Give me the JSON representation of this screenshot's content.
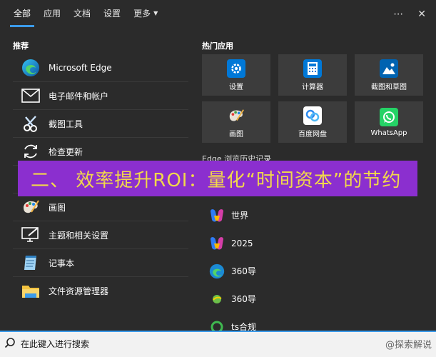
{
  "tabs": [
    {
      "label": "全部",
      "active": true
    },
    {
      "label": "应用"
    },
    {
      "label": "文档"
    },
    {
      "label": "设置"
    },
    {
      "label": "更多"
    }
  ],
  "window": {
    "more_icon": "ellipsis-icon",
    "close_icon": "close-icon"
  },
  "left": {
    "title": "推荐",
    "items": [
      {
        "label": "Microsoft Edge",
        "icon": "edge-icon"
      },
      {
        "label": "电子邮件和帐户",
        "icon": "mail-icon"
      },
      {
        "label": "截图工具",
        "icon": "snipping-tool-icon"
      },
      {
        "label": "检查更新",
        "icon": "refresh-icon"
      },
      {
        "label": "画图",
        "icon": "paint-icon"
      },
      {
        "label": "主题和相关设置",
        "icon": "theme-icon"
      },
      {
        "label": "记事本",
        "icon": "notepad-icon"
      },
      {
        "label": "文件资源管理器",
        "icon": "folder-icon"
      }
    ]
  },
  "right": {
    "title": "热门应用",
    "apps": [
      {
        "label": "设置",
        "icon": "gear-icon",
        "color": "#0078d7"
      },
      {
        "label": "计算器",
        "icon": "calculator-icon",
        "color": "#0078d7"
      },
      {
        "label": "截图和草图",
        "icon": "snip-sketch-icon",
        "color": "#0063b1"
      },
      {
        "label": "画图",
        "icon": "paint-icon",
        "color": "#3c3c3c"
      },
      {
        "label": "百度网盘",
        "icon": "baidu-netdisk-icon",
        "color": "#ffffff"
      },
      {
        "label": "WhatsApp",
        "icon": "whatsapp-icon",
        "color": "#25d366"
      }
    ],
    "recent_title": "Edge 浏览历史记录",
    "recent": [
      {
        "label": "世界",
        "icon": "copilot-icon"
      },
      {
        "label": "2025",
        "icon": "copilot-icon"
      },
      {
        "label": "360导",
        "icon": "edge-icon"
      },
      {
        "label": "360导",
        "icon": "360-icon"
      },
      {
        "label": "ts合规",
        "icon": "green-ring-icon"
      }
    ]
  },
  "overlay": {
    "text": "二、 效率提升ROI：量化“时间资本”的节约"
  },
  "search": {
    "placeholder": "在此键入进行搜索",
    "watermark": "@探索解说"
  },
  "colors": {
    "accent": "#3b9bea",
    "overlay_bg": "#8b2fcf",
    "overlay_text": "#f2d94a"
  }
}
